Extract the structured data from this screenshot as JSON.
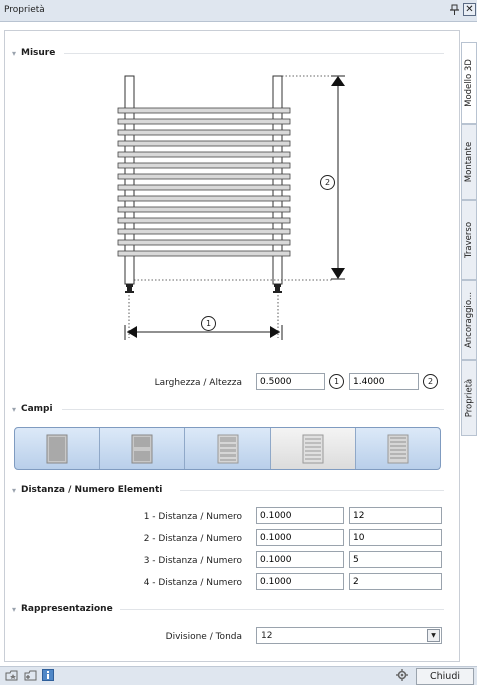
{
  "window": {
    "title": "Proprietà",
    "pin_glyph": "ᵖ",
    "close_glyph": "✕"
  },
  "side_tabs": [
    "Modello 3D",
    "Montante",
    "Traverso",
    "Ancoraggio...",
    "Proprietà"
  ],
  "sections": {
    "misure": {
      "label": "Misure",
      "drawing": {
        "dim1": "1",
        "dim2": "2"
      },
      "row_label": "Larghezza / Altezza",
      "width_value": "0.5000",
      "height_value": "1.4000",
      "badge1": "1",
      "badge2": "2"
    },
    "campi": {
      "label": "Campi",
      "options": [
        "campi-1",
        "campi-2",
        "campi-3",
        "campi-4",
        "campi-5"
      ],
      "selected": 3
    },
    "distanza": {
      "label": "Distanza / Numero Elementi",
      "rows": [
        {
          "label": "1 - Distanza / Numero",
          "distanza": "0.1000",
          "numero": "12"
        },
        {
          "label": "2 - Distanza / Numero",
          "distanza": "0.1000",
          "numero": "10"
        },
        {
          "label": "3 - Distanza / Numero",
          "distanza": "0.1000",
          "numero": "5"
        },
        {
          "label": "4 - Distanza / Numero",
          "distanza": "0.1000",
          "numero": "2"
        }
      ]
    },
    "rappresentazione": {
      "label": "Rappresentazione",
      "row_label": "Divisione / Tonda",
      "value": "12"
    }
  },
  "footer": {
    "close_label": "Chiudi",
    "icons": [
      "open-favorites-icon",
      "save-favorites-icon",
      "info-icon",
      "settings-icon"
    ]
  }
}
